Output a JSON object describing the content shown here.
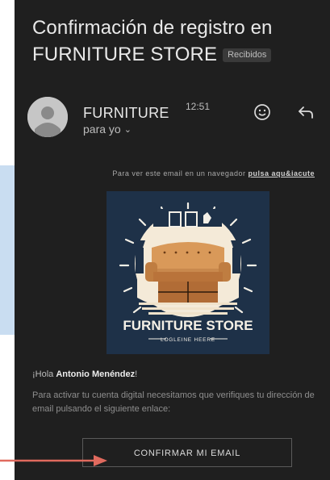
{
  "email": {
    "subject_line1": "Confirmación de registro en",
    "subject_line2": "FURNITURE STORE",
    "label_badge": "Recibidos"
  },
  "sender": {
    "name": "FURNITURE",
    "time": "12:51",
    "recipient": "para yo",
    "icons": [
      "avatar-person-icon",
      "emoji-icon",
      "reply-icon",
      "chevron-down-icon"
    ]
  },
  "body": {
    "browser_text": "Para ver este email en un navegador",
    "browser_link": "pulsa aqu&iacute",
    "logo": {
      "brand": "FURNITURE STORE",
      "tagline": "LOGLEINE HEERE"
    },
    "greeting_prefix": "¡Hola ",
    "greeting_name": "Antonio Menéndez",
    "greeting_suffix": "!",
    "instructions": "Para activar tu cuenta digital necesitamos que verifiques tu dirección de email pulsando el siguiente enlace:",
    "confirm_button": "CONFIRMAR MI EMAIL"
  },
  "colors": {
    "background": "#1f1f1f",
    "logo_background": "#1e3148",
    "annotation_arrow": "#e06a5e",
    "side_panel": "#c9ddf1"
  }
}
